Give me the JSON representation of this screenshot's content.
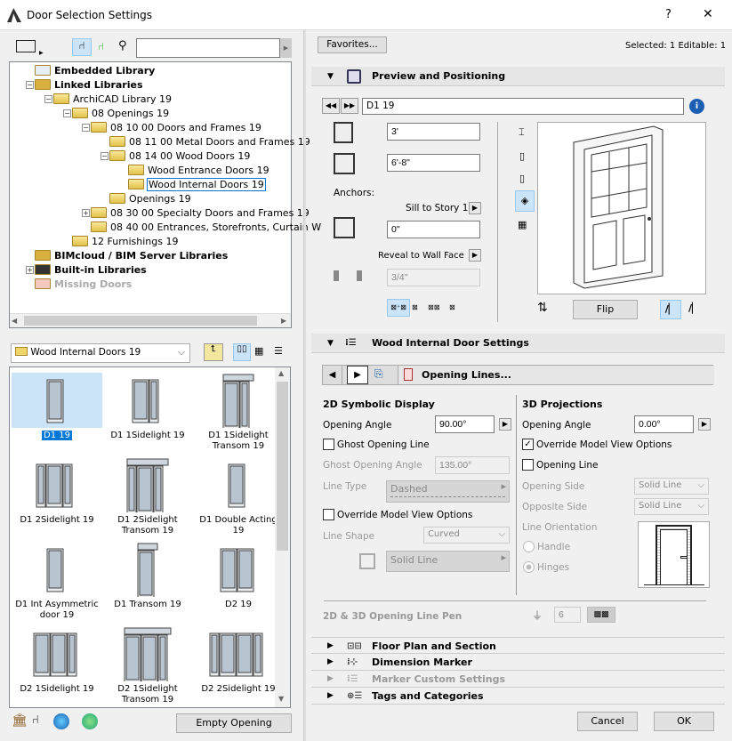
{
  "window": {
    "title": "Door Selection Settings",
    "help": "?",
    "close": "✕"
  },
  "left": {
    "search_placeholder": "",
    "tree": [
      {
        "label": "Embedded Library",
        "bold": true,
        "level": 0
      },
      {
        "label": "Linked Libraries",
        "bold": true,
        "level": 0
      },
      {
        "label": "ArchiCAD Library 19",
        "level": 1
      },
      {
        "label": "08 Openings 19",
        "level": 2
      },
      {
        "label": "08 10 00 Doors and Frames 19",
        "level": 3
      },
      {
        "label": "08 11 00 Metal Doors and Frames 19",
        "level": 4
      },
      {
        "label": "08 14 00 Wood Doors 19",
        "level": 4
      },
      {
        "label": "Wood Entrance Doors 19",
        "level": 5
      },
      {
        "label": "Wood Internal Doors 19",
        "level": 5,
        "selected": true
      },
      {
        "label": "Openings 19",
        "level": 4
      },
      {
        "label": "08 30 00 Specialty Doors and Frames 19",
        "level": 3
      },
      {
        "label": "08 40 00 Entrances, Storefronts, Curtain W",
        "level": 3
      },
      {
        "label": "12 Furnishings 19",
        "level": 2
      },
      {
        "label": "BIMcloud / BIM Server Libraries",
        "bold": true,
        "level": 0
      },
      {
        "label": "Built-in Libraries",
        "bold": true,
        "level": 0
      },
      {
        "label": "Missing Doors",
        "bold": true,
        "level": 0,
        "disabled": true
      }
    ],
    "folder_select": "Wood Internal Doors 19",
    "items": [
      "D1 19",
      "D1 1Sidelight 19",
      "D1 1Sidelight Transom 19",
      "D1 2Sidelight 19",
      "D1 2Sidelight Transom 19",
      "D1 Double Acting 19",
      "D1 Int Asymmetric door 19",
      "D1 Transom 19",
      "D2 19",
      "D2 1Sidelight 19",
      "D2 1Sidelight Transom 19",
      "D2 2Sidelight 19"
    ],
    "empty_opening": "Empty Opening"
  },
  "right": {
    "favorites": "Favorites...",
    "selected_info": "Selected: 1 Editable: 1",
    "preview": {
      "title": "Preview and Positioning",
      "name": "D1 19",
      "width": "3'",
      "height": "6'-8\"",
      "anchors": "Anchors:",
      "sill": "Sill to Story 1",
      "sill_value": "0\"",
      "reveal": "Reveal to Wall Face",
      "reveal_value": "3/4\"",
      "flip": "Flip"
    },
    "settings": {
      "title": "Wood Internal Door Settings",
      "page": "Opening Lines...",
      "sym": {
        "title": "2D Symbolic Display",
        "opening_angle_label": "Opening Angle",
        "opening_angle": "90.00°",
        "ghost_line": "Ghost Opening Line",
        "ghost_angle_label": "Ghost Opening Angle",
        "ghost_angle": "135.00°",
        "line_type_label": "Line Type",
        "line_type": "Dashed",
        "override": "Override Model View Options",
        "line_shape_label": "Line Shape",
        "line_shape": "Curved",
        "solid_line": "Solid Line"
      },
      "proj": {
        "title": "3D Projections",
        "opening_angle_label": "Opening Angle",
        "opening_angle": "0.00°",
        "override": "Override Model View Options",
        "opening_line": "Opening Line",
        "opening_side_label": "Opening Side",
        "opening_side": "Solid Line",
        "opposite_side_label": "Opposite Side",
        "opposite_side": "Solid Line",
        "orientation_label": "Line Orientation",
        "handle": "Handle",
        "hinges": "Hinges"
      },
      "pen_label": "2D & 3D Opening Line Pen",
      "pen": "6"
    },
    "sections": [
      "Floor Plan and Section",
      "Dimension Marker",
      "Marker Custom Settings",
      "Tags and Categories"
    ],
    "cancel": "Cancel",
    "ok": "OK"
  }
}
